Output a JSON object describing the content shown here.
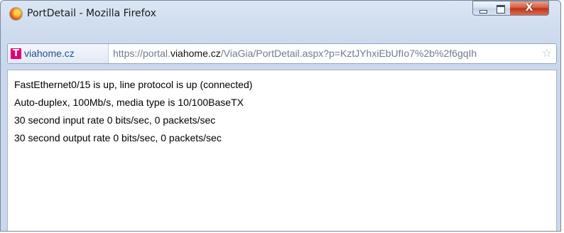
{
  "window": {
    "title": "PortDetail - Mozilla Firefox",
    "close_glyph": "X"
  },
  "urlbar": {
    "identity_logo": "T",
    "identity_label": "viahome.cz",
    "url_prefix": "https://portal.",
    "url_domain": "viahome.cz",
    "url_path": "/ViaGia/PortDetail.aspx?p=KztJYhxiEbUfIo7%2b%2f6gqIh",
    "star_glyph": "☆"
  },
  "content": {
    "lines": [
      "FastEthernet0/15 is up, line protocol is up (connected)",
      "Auto-duplex, 100Mb/s, media type is 10/100BaseTX",
      "30 second input rate 0 bits/sec, 0 packets/sec",
      "30 second output rate 0 bits/sec, 0 packets/sec"
    ]
  },
  "colors": {
    "frame": "#cfdcee",
    "close_button": "#c7391c",
    "telekom_magenta": "#e20074",
    "identity_text": "#1f4f8f"
  },
  "icons": [
    "firefox-icon",
    "minimize-icon",
    "maximize-icon",
    "close-icon",
    "telekom-icon",
    "bookmark-star-icon"
  ]
}
